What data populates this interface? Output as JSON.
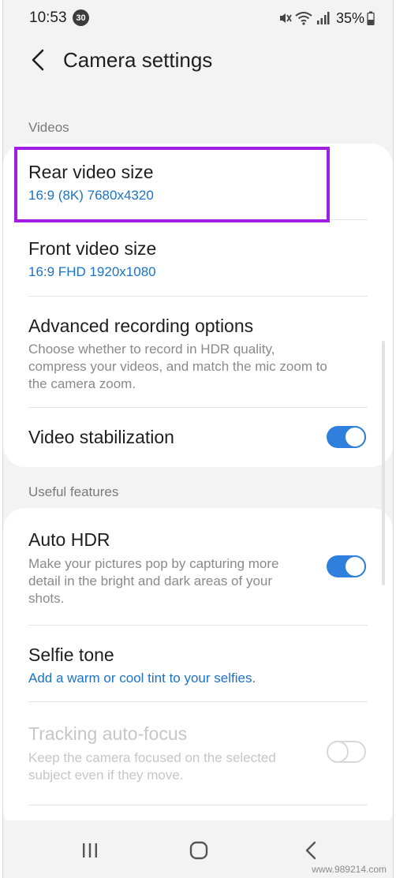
{
  "status_bar": {
    "time": "10:53",
    "notification_count": "30",
    "battery": "35%",
    "icons": [
      "mute-icon",
      "wifi-icon",
      "signal-icon",
      "battery-icon"
    ]
  },
  "header": {
    "title": "Camera settings",
    "back_icon": "back-arrow-icon"
  },
  "sections": {
    "videos": {
      "title": "Videos",
      "items": [
        {
          "title": "Rear video size",
          "value": "16:9 (8K) 7680x4320"
        },
        {
          "title": "Front video size",
          "value": "16:9 FHD 1920x1080"
        },
        {
          "title": "Advanced recording options",
          "desc": "Choose whether to record in HDR quality, compress your videos, and match the mic zoom to the camera zoom."
        },
        {
          "title": "Video stabilization",
          "toggle": "on"
        }
      ]
    },
    "useful": {
      "title": "Useful features",
      "items": [
        {
          "title": "Auto HDR",
          "desc": "Make your pictures pop by capturing more detail in the bright and dark areas of your shots.",
          "toggle": "on"
        },
        {
          "title": "Selfie tone",
          "value": "Add a warm or cool tint to your selfies."
        },
        {
          "title": "Tracking auto-focus",
          "desc": "Keep the camera focused on the selected subject even if they move.",
          "toggle": "off",
          "disabled": true
        }
      ]
    }
  },
  "nav": {
    "recents_icon": "recents-icon",
    "home_icon": "home-icon",
    "back_icon": "back-icon"
  },
  "watermark": "www.989214.com",
  "colors": {
    "accent": "#2f80dc",
    "link": "#1a73c8",
    "highlight": "#a21de3",
    "background": "#f3f3f3"
  }
}
